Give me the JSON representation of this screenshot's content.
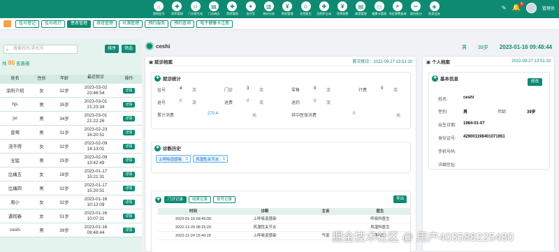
{
  "topnav": {
    "items": [
      {
        "label": "我的挂号",
        "icon": "home-icon",
        "glyph": "⌂"
      },
      {
        "label": "药库管理",
        "icon": "pill-icon",
        "glyph": "✚"
      },
      {
        "label": "门诊医生站",
        "icon": "doctor-icon",
        "glyph": "☺"
      },
      {
        "label": "门诊病历",
        "icon": "record-icon",
        "glyph": "▤"
      },
      {
        "label": "药房管理",
        "icon": "pharmacy-icon",
        "glyph": "✚"
      },
      {
        "label": "治疗室",
        "icon": "treatment-icon",
        "glyph": "✦"
      },
      {
        "label": "统计分析",
        "icon": "chart-icon",
        "glyph": "▥"
      },
      {
        "label": "财务管理",
        "icon": "finance-icon",
        "glyph": "¥"
      },
      {
        "label": "住院医生",
        "icon": "inpatient-doctor-icon",
        "glyph": "☺"
      },
      {
        "label": "住院护士站",
        "icon": "nurse-icon",
        "glyph": "✚"
      },
      {
        "label": "住院收费",
        "icon": "billing-icon",
        "glyph": "¥"
      },
      {
        "label": "病案管理",
        "icon": "case-icon",
        "glyph": "▤"
      },
      {
        "label": "健康卡管理",
        "icon": "card-icon",
        "glyph": "▭"
      },
      {
        "label": "项目收费查询",
        "icon": "query-icon",
        "glyph": "⌕"
      },
      {
        "label": "病历拆分",
        "icon": "split-icon",
        "glyph": "✂"
      },
      {
        "label": "医保业务",
        "icon": "insurance-icon",
        "glyph": "◈"
      }
    ],
    "notif_count": "6",
    "username": "管理员"
  },
  "tabs": [
    "挂号登记",
    "挂号统计",
    "患者管理",
    "排班管理",
    "号源管理",
    "预约服务",
    "预约查询",
    "电子健康卡注册"
  ],
  "active_tab": 2,
  "search": {
    "placeholder": "搜索姓名/手机号",
    "sort_btn": "排序",
    "filter_btn": "筛选"
  },
  "patient_count": {
    "prefix": "共",
    "num": "86",
    "suffix": "名患者"
  },
  "patient_table": {
    "headers": [
      "姓名",
      "性别",
      "年龄",
      "最近就诊",
      "操作"
    ],
    "rows": [
      [
        "涂所介绍",
        "女",
        "32岁",
        "2023-03-02 23:46:54",
        "详情"
      ],
      [
        "hjs",
        "男",
        "35岁",
        "2023-03-01 21:23:34",
        "详情"
      ],
      [
        "jui",
        "男",
        "34岁",
        "2023-03-01 21:22:26",
        "详情"
      ],
      [
        "曾莺",
        "男",
        "31岁",
        "2023-02-23 16:20:51",
        "详情"
      ],
      [
        "浇不得",
        "女",
        "32岁",
        "2023-02-09 14:13:01",
        "详情"
      ],
      [
        "全猛",
        "男",
        "25岁",
        "2023-02-09 13:42:49",
        "详情"
      ],
      [
        "比痛五",
        "女",
        "28岁",
        "2023-01-17 15:21:31",
        "详情"
      ],
      [
        "比痛四",
        "男",
        "32岁",
        "2023-01-17 15:20:51",
        "详情"
      ],
      [
        "周小",
        "女",
        "32岁",
        "2023-01-16 10:12:09",
        "详情"
      ],
      [
        "遇彻春",
        "女",
        "51岁",
        "2023-01-16 10:07:31",
        "详情"
      ],
      [
        "ceshi",
        "男",
        "39岁",
        "2023-01-16 09:48:44",
        "详情"
      ]
    ]
  },
  "patient": {
    "name": "ceshi",
    "gender": "男",
    "age": "39岁",
    "datetime": "2023-01-16 09:48:44"
  },
  "visit_archive": {
    "title": "就诊档案",
    "first_visit": "首次就诊：2022-09-27 13:51:10"
  },
  "stats": {
    "title": "就诊统计",
    "r1": [
      [
        "挂号",
        "4",
        "次"
      ],
      [
        "门诊",
        "3",
        "次"
      ],
      [
        "零售",
        "0",
        "次"
      ],
      [
        "行费",
        "0",
        "次"
      ]
    ],
    "r2": [
      [
        "退号",
        "0",
        "次"
      ],
      [
        "退费",
        "0",
        "次"
      ],
      [
        "退药",
        "0",
        "次"
      ]
    ],
    "total_label": "累计消费",
    "total_val": "270.4",
    "unit": "元",
    "ins_label": "其中医保消费",
    "ins_val": "0",
    "ins_unit": "元"
  },
  "diag": {
    "title": "诊断历史",
    "chips": [
      {
        "name": "上呼吸道感染",
        "n": "2"
      },
      {
        "name": "风湿性关节炎",
        "n": "1"
      }
    ]
  },
  "records": {
    "tabs": [
      "门诊记录",
      "收费记录",
      "挂号记录"
    ],
    "export": "导出",
    "headers": [
      "时间",
      "诊断",
      "主诉",
      "医生"
    ],
    "rows": [
      [
        "2023-01-16 09:45:00",
        "上呼吸道感染",
        "",
        "呼吸科医生"
      ],
      [
        "2022-12-29 08:25:20",
        "风湿性关节炎",
        "",
        "风湿科医生"
      ],
      [
        "2022-11-24 15:40:29",
        "上呼吸道感染",
        "气促",
        "李慧佳"
      ]
    ]
  },
  "profile": {
    "title": "个人档案",
    "created": "2022-09-27 13:51:10",
    "basic": "基本信息",
    "edit": "修改",
    "name_label": "姓名:",
    "name": "ceshi",
    "gender_label": "性别:",
    "gender": "男",
    "age_label": "年龄:",
    "age": "39岁",
    "birth_label": "出生日期:",
    "birth": "1984-01-07",
    "id_label": "身份证号:",
    "id": "429001198401071651",
    "phone_label": "手机号码:",
    "phone": "",
    "addr_label": "详细住址:",
    "addr": ""
  },
  "watermark": "掘金技术社区 @ 用户403588225480",
  "colors": {
    "primary": "#0e8a72",
    "accent": "#f4a340",
    "danger": "#e53935",
    "link": "#1e88e5"
  }
}
